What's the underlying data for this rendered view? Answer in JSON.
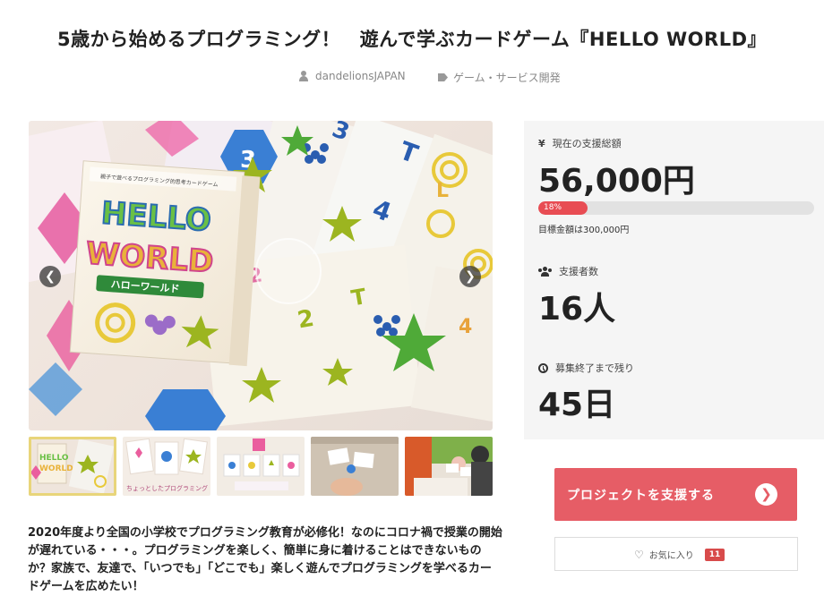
{
  "project": {
    "title": "5歳から始めるプログラミング！　遊んで学ぶカードゲーム『HELLO WORLD』",
    "author": "dandelionsJAPAN",
    "category": "ゲーム・サービス開発"
  },
  "gallery": {
    "box_top_text": "親子で遊べるプログラミング的思考カードゲーム",
    "box_title_line1": "HELLO",
    "box_title_line2": "WORLD",
    "box_subtitle": "ハローワールド",
    "prev_icon": "chevron-left-icon",
    "next_icon": "chevron-right-icon",
    "thumbnails": [
      "thumb-1",
      "thumb-2",
      "thumb-3",
      "thumb-4",
      "thumb-5"
    ],
    "thumb2_caption": "ちょっとしたプログラミング"
  },
  "stats": {
    "total_label": "現在の支援総額",
    "total_icon": "yen-icon",
    "total_value": "56,000円",
    "progress_text": "18%",
    "progress_fraction": 0.18,
    "goal_text": "目標金額は300,000円",
    "supporters_label": "支援者数",
    "supporters_icon": "users-icon",
    "supporters_value": "16人",
    "remaining_label": "募集終了まで残り",
    "remaining_icon": "clock-icon",
    "remaining_value": "45日"
  },
  "actions": {
    "support_label": "プロジェクトを支援する",
    "support_icon": "chevron-circle-right-icon",
    "favorite_label": "お気に入り",
    "favorite_icon": "heart-icon",
    "favorite_count": "11"
  },
  "description": "2020年度より全国の小学校でプログラミング教育が必修化！なのにコロナ禍で授業の開始が遅れている・・・。プログラミングを楽しく、簡単に身に着けることはできないものか？家族で、友達で、「いつでも」「どこでも」楽しく遊んでプログラミングを学べるカードゲームを広めたい！",
  "colors": {
    "accent": "#e65d66",
    "progress": "#e84c53",
    "panel_bg": "#f5f5f5",
    "badge": "#d84b4b"
  }
}
